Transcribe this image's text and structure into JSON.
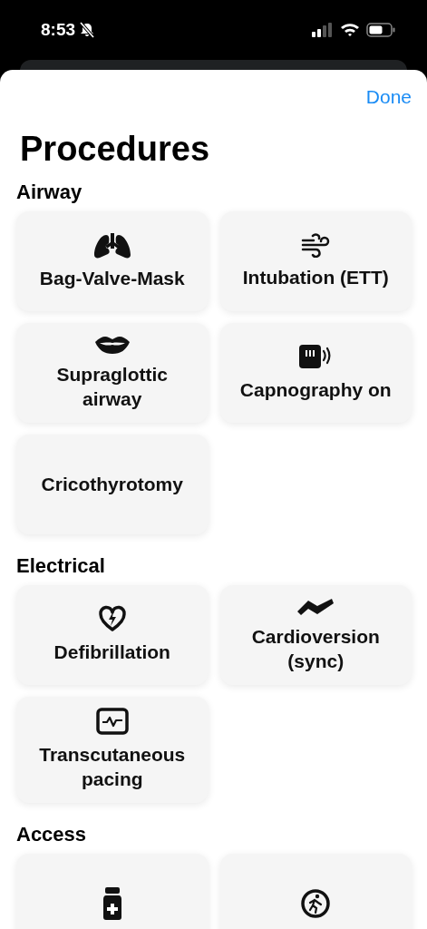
{
  "status_bar": {
    "time": "8:53",
    "silent": true
  },
  "sheet": {
    "done_label": "Done",
    "title": "Procedures"
  },
  "sections": [
    {
      "title": "Airway",
      "items": [
        {
          "kind": "labeled",
          "label": "Bag-Valve-Mask"
        },
        {
          "kind": "labeled",
          "label": "Intubation (ETT)"
        },
        {
          "kind": "labeled",
          "label": "Supraglottic airway"
        },
        {
          "kind": "labeled",
          "label": "Capnography on"
        },
        {
          "kind": "labeled",
          "label": "Cricothyrotomy"
        }
      ]
    },
    {
      "title": "Electrical",
      "items": [
        {
          "kind": "labeled",
          "label": "Defibrillation"
        },
        {
          "kind": "labeled",
          "label": "Cardioversion (sync)"
        },
        {
          "kind": "labeled",
          "label": "Transcutaneous pacing"
        }
      ]
    },
    {
      "title": "Access",
      "items": [
        {
          "kind": "icon-only"
        },
        {
          "kind": "icon-only"
        }
      ]
    }
  ]
}
